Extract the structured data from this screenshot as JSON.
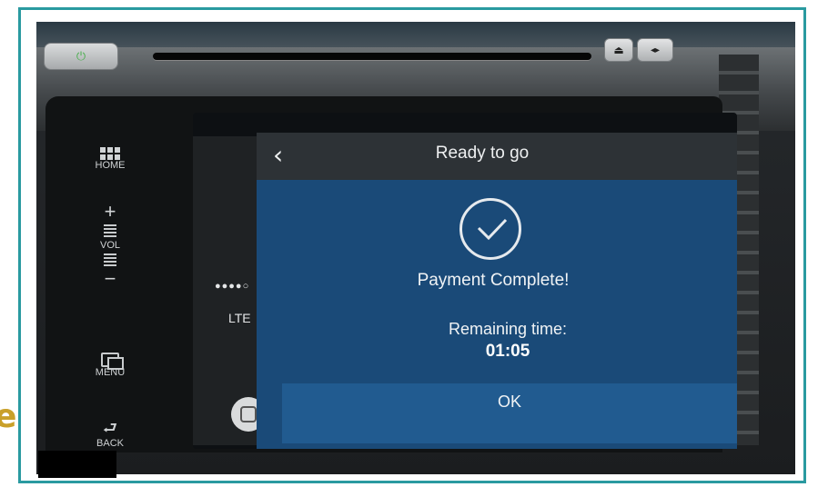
{
  "overlay": {
    "partial_text": "e"
  },
  "dashboard": {
    "power_symbol": "⏻",
    "eject_symbol": "⏏",
    "source_symbol": "◂▸"
  },
  "hardware_buttons": {
    "home_label": "HOME",
    "vol_plus": "+",
    "vol_label": "VOL",
    "vol_minus": "−",
    "menu_label": "MENU",
    "back_label": "BACK"
  },
  "carplay_sidebar": {
    "signal_dots": "●●●●○",
    "network": "LTE"
  },
  "app": {
    "back_icon": "‹",
    "title": "Ready to go",
    "status_message": "Payment Complete!",
    "remaining_label": "Remaining time:",
    "remaining_value": "01:05",
    "ok_button": "OK"
  },
  "colors": {
    "accent_frame": "#2a9aa0",
    "app_background": "#1a4a78",
    "ok_bar": "#215b90",
    "header": "#2d3236",
    "partial_text": "#c9a02a"
  }
}
